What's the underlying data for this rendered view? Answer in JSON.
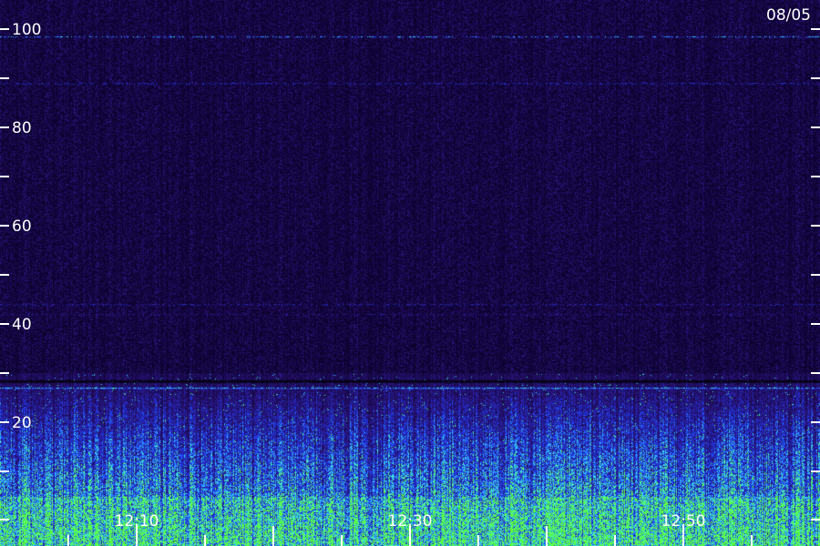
{
  "chart_data": {
    "type": "heatmap",
    "date_label": "08/05",
    "y_axis": {
      "range": [
        0,
        100
      ],
      "labeled_ticks": [
        "100",
        "80",
        "60",
        "40",
        "20"
      ],
      "labeled_tick_values": [
        100,
        80,
        60,
        40,
        20
      ],
      "minor_tick_values": [
        90,
        70,
        50,
        30,
        10,
        0
      ]
    },
    "x_axis": {
      "time_labels": [
        "12:10",
        "12:30",
        "12:50"
      ],
      "time_start": "12:00",
      "time_end": "13:00",
      "tick_interval_min": 5
    },
    "features": [
      {
        "y": 98.5,
        "intensity": 0.7
      },
      {
        "y": 89,
        "intensity": 0.5
      },
      {
        "y": 44,
        "intensity": 0.45
      },
      {
        "y": 42,
        "intensity": 0.35
      },
      {
        "y": 27,
        "intensity": 0.8
      }
    ],
    "colors": {
      "background": "#000000",
      "low": "#2a1470",
      "mid": "#1e3cff",
      "high": "#36e0ff",
      "peak": "#5cff3c",
      "text": "#ffffff"
    }
  }
}
